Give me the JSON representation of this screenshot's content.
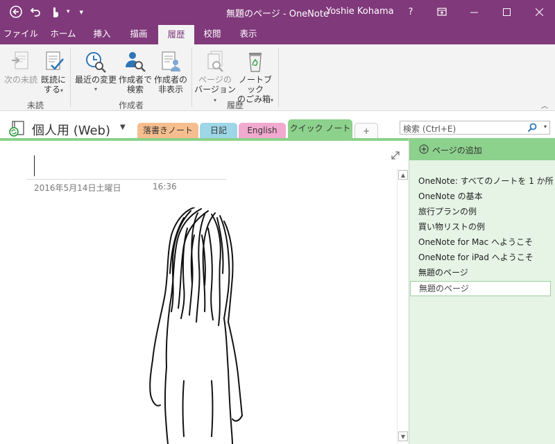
{
  "titlebar": {
    "title": "無題のページ - OneNote",
    "user": "Yoshie Kohama",
    "help": "?",
    "customize_glyph": "▾",
    "touch_dropdown": "▾"
  },
  "ribbon_tabs": [
    "ファイル",
    "ホーム",
    "挿入",
    "描画",
    "履歴",
    "校閲",
    "表示"
  ],
  "active_tab": "履歴",
  "ribbon": {
    "next_unread": "次の未読",
    "mark_read_1": "既読に",
    "mark_read_2": "する",
    "recent_edits": "最近の変更",
    "find_by_author_1": "作成者で",
    "find_by_author_2": "検索",
    "hide_authors_1": "作成者の",
    "hide_authors_2": "非表示",
    "page_versions_1": "ページの",
    "page_versions_2": "バージョン",
    "recycle_bin_1": "ノートブック",
    "recycle_bin_2": "のごみ箱",
    "caret": "▾",
    "group_unread": "未読",
    "group_authors": "作成者",
    "group_history": "履歴",
    "collapse": "︿"
  },
  "notebook": {
    "name": "個人用 (Web)",
    "dropdown": "▼",
    "sections": [
      {
        "label": "落書きノート",
        "color": "#f6be8e"
      },
      {
        "label": "日記",
        "color": "#9dd6e7"
      },
      {
        "label": "English",
        "color": "#f2a9cf"
      },
      {
        "label": "クイック ノート",
        "color": "#8cd18c"
      }
    ],
    "add_section": "+"
  },
  "search": {
    "placeholder": "検索 (Ctrl+E)",
    "dropdown": "▾"
  },
  "page": {
    "date": "2016年5月14日土曜日",
    "time": "16:36"
  },
  "scroll": {
    "up": "▲",
    "down": "▼"
  },
  "pages_panel": {
    "add_page": "ページの追加",
    "items": [
      "OneNote: すべてのノートを 1 か所",
      "OneNote の基本",
      "旅行プランの例",
      "買い物リストの例",
      "OneNote for Mac へようこそ",
      "OneNote for iPad へようこそ",
      "無題のページ",
      "無題のページ"
    ]
  },
  "colors": {
    "accent": "#80397b",
    "section_green": "#8cd18c",
    "page_panel_bg": "#e6f4e6"
  }
}
